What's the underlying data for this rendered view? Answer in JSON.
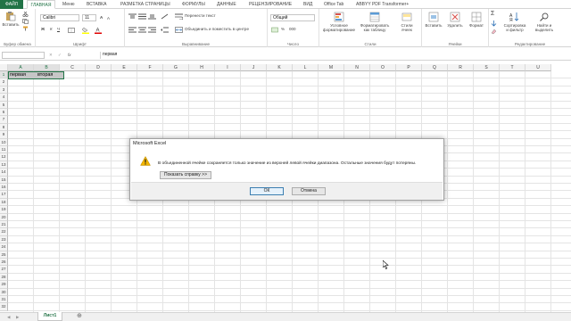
{
  "colors": {
    "accent": "#217346",
    "selected_fill": "#c6c6c6",
    "warning": "#f2b400"
  },
  "tabs": [
    "ФАЙЛ",
    "ГЛАВНАЯ",
    "Меню",
    "ВСТАВКА",
    "РАЗМЕТКА СТРАНИЦЫ",
    "ФОРМУЛЫ",
    "ДАННЫЕ",
    "РЕЦЕНЗИРОВАНИЕ",
    "ВИД",
    "Office Tab",
    "ABBYY PDF Transformer+"
  ],
  "ribbon": {
    "paste_label": "Вставить",
    "font_name": "Calibri",
    "font_size": "11",
    "wrap_text": "Перенести текст",
    "merge_center": "Объединить и поместить в центре",
    "number_format": "Общий",
    "conditional_formatting": [
      "Условное",
      "форматирование"
    ],
    "format_as_table": [
      "Форматировать",
      "как таблицу"
    ],
    "cell_styles": [
      "Стили",
      "ячеек"
    ],
    "insert": "Вставить",
    "delete": "Удалить",
    "format": "Формат",
    "sort_filter": [
      "Сортировка",
      "и фильтр"
    ],
    "find_select": [
      "Найти и",
      "выделить"
    ],
    "groups": [
      "Буфер обмена",
      "Шрифт",
      "Выравнивание",
      "Число",
      "Стили",
      "Ячейки",
      "Редактирование"
    ]
  },
  "formula_bar": {
    "name_box": "",
    "fx": "fx",
    "value": "первая"
  },
  "columns": [
    "A",
    "B",
    "C",
    "D",
    "E",
    "F",
    "G",
    "H",
    "I",
    "J",
    "K",
    "L",
    "M",
    "N",
    "O",
    "P",
    "Q",
    "R",
    "S",
    "T",
    "U"
  ],
  "rows": [
    "1",
    "2",
    "3",
    "4",
    "5",
    "6",
    "7",
    "8",
    "9",
    "10",
    "11",
    "12",
    "13",
    "14",
    "15",
    "16",
    "17",
    "18",
    "19",
    "20",
    "21",
    "22",
    "23",
    "24",
    "25",
    "26",
    "27",
    "28",
    "29",
    "30",
    "31",
    "32"
  ],
  "cells": {
    "a1": "первая",
    "b1": "вторая"
  },
  "dialog": {
    "title": "Microsoft Excel",
    "message": "В объединенной ячейке сохраняется только значение из верхней левой ячейки диапазона. Остальные значения будут потеряны.",
    "help_button": "Показать справку >>",
    "ok": "ОК",
    "cancel": "Отмена"
  },
  "sheet_tab": "Лист1"
}
